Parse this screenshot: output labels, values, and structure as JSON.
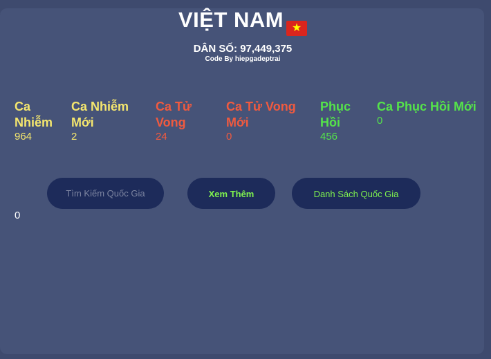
{
  "header": {
    "country": "VIỆT NAM",
    "flag_icon": "vietnam-flag-icon",
    "population": "DÂN SỐ: 97,449,375",
    "credit": "Code By hiepgadeptrai"
  },
  "stats": {
    "cases": {
      "label": "Ca Nhiễm",
      "value": "964"
    },
    "new_cases": {
      "label": "Ca Nhiễm Mới",
      "value": "2"
    },
    "deaths": {
      "label": "Ca Tử Vong",
      "value": "24"
    },
    "new_deaths": {
      "label": "Ca Tử Vong Mới",
      "value": "0"
    },
    "recovered": {
      "label": "Phục Hồi",
      "value": "456"
    },
    "new_recovered": {
      "label": "Ca Phục Hồi Mới",
      "value": "0"
    }
  },
  "actions": {
    "search_placeholder": "Tìm Kiếm Quốc Gia",
    "more_label": "Xem Thêm",
    "list_label": "Danh Sách Quốc Gia"
  },
  "result": {
    "value": "0"
  },
  "colors": {
    "background": "#3e4a6e",
    "card": "#465378",
    "yellow": "#f5e76e",
    "red": "#f05a3f",
    "green": "#55e34a",
    "button": "#1d2b5a"
  }
}
